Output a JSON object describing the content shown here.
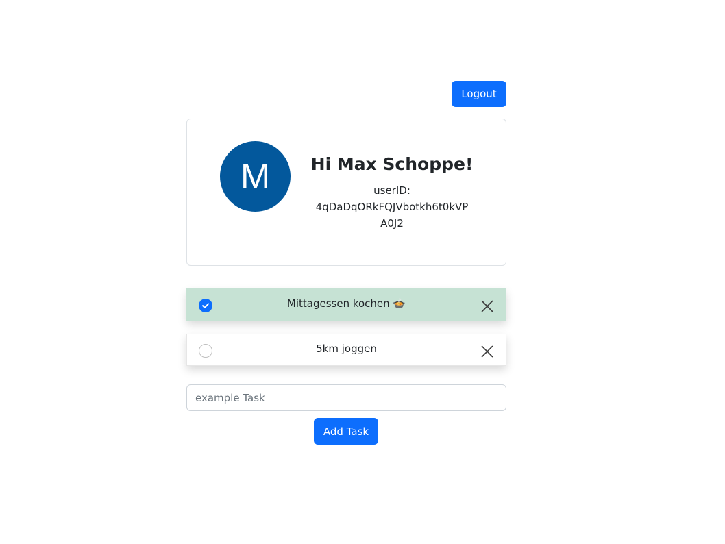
{
  "header": {
    "logout_label": "Logout"
  },
  "profile": {
    "avatar_initial": "M",
    "greeting": "Hi Max Schoppe!",
    "userid_label": "userID:",
    "userid_value": "4qDaDqORkFQJVbotkh6t0kVPA0J2"
  },
  "tasks": [
    {
      "text": "Mittagessen kochen 🍲",
      "completed": true
    },
    {
      "text": "5km joggen",
      "completed": false
    }
  ],
  "new_task": {
    "value": "",
    "placeholder": "example Task",
    "add_label": "Add Task"
  },
  "colors": {
    "accent": "#0d6efd",
    "avatar_bg": "#03589c",
    "completed_bg": "#c6e2d4"
  }
}
